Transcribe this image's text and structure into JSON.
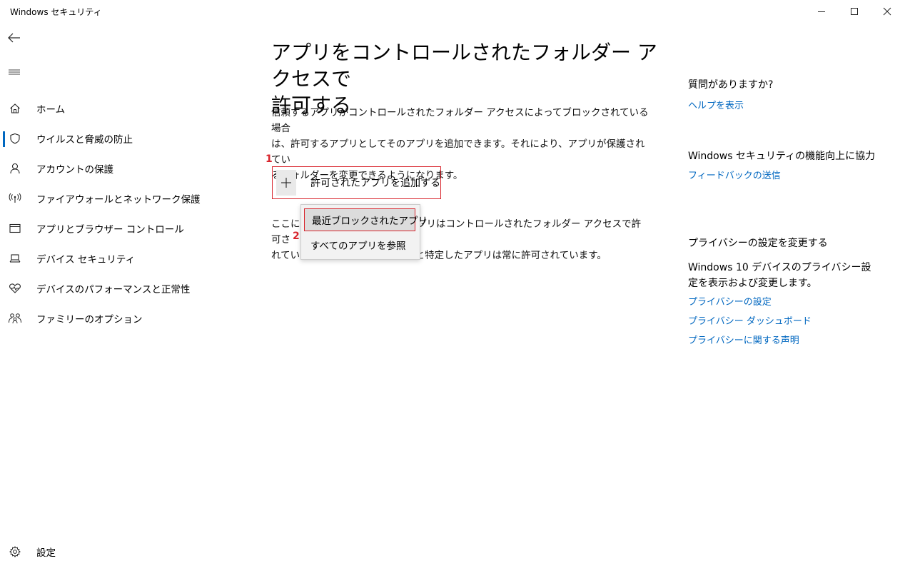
{
  "app": {
    "title": "Windows セキュリティ"
  },
  "window_controls": {
    "minimize": "minimize-icon",
    "maximize": "maximize-icon",
    "close": "close-icon"
  },
  "nav": {
    "items": [
      {
        "label": "ホーム",
        "icon": "home-icon",
        "active": false
      },
      {
        "label": "ウイルスと脅威の防止",
        "icon": "shield-icon",
        "active": true
      },
      {
        "label": "アカウントの保護",
        "icon": "person-icon",
        "active": false
      },
      {
        "label": "ファイアウォールとネットワーク保護",
        "icon": "wifi-antenna-icon",
        "active": false
      },
      {
        "label": "アプリとブラウザー コントロール",
        "icon": "browser-window-icon",
        "active": false
      },
      {
        "label": "デバイス セキュリティ",
        "icon": "laptop-icon",
        "active": false
      },
      {
        "label": "デバイスのパフォーマンスと正常性",
        "icon": "heart-icon",
        "active": false
      },
      {
        "label": "ファミリーのオプション",
        "icon": "family-icon",
        "active": false
      }
    ],
    "settings_label": "設定"
  },
  "main": {
    "title_line1": "アプリをコントロールされたフォルダー アクセスで",
    "title_line2": "許可する",
    "description_line1": "信頼するアプリがコントロールされたフォルダー アクセスによってブロックされている場合",
    "description_line2": "は、許可するアプリとしてそのアプリを追加できます。それにより、アプリが保護されてい",
    "description_line3": "るフォルダーを変更できるようになります。",
    "add_button_label": "許可されたアプリを追加する",
    "info_line1": "ここに追加したアプリは、その他のアプリはコントロールされたフォルダー アクセスで許可さ",
    "info_line2": "れていると特定したアプリは常に許可されています。",
    "info_line1_visible_a": "ここに追",
    "info_line1_visible_b": "プリはコントロールされたフォルダー アクセスで許可さ",
    "info_line2_visible_a": "れてい",
    "info_line2_visible_b": "リと特定したアプリは常に許可されています。"
  },
  "dropdown": {
    "items": [
      "最近ブロックされたアプリ",
      "すべてのアプリを参照"
    ]
  },
  "annotations": {
    "step1": "1",
    "step2": "2",
    "color": "#d8242c"
  },
  "right_panel": {
    "question_heading": "質問がありますか?",
    "help_link": "ヘルプを表示",
    "improve_heading": "Windows セキュリティの機能向上に協力",
    "feedback_link": "フィードバックの送信",
    "privacy_heading": "プライバシーの設定を変更する",
    "privacy_text": "Windows 10 デバイスのプライバシー設定を表示および変更します。",
    "privacy_links": [
      "プライバシーの設定",
      "プライバシー ダッシュボード",
      "プライバシーに関する声明"
    ]
  },
  "colors": {
    "accent": "#0067c0",
    "annotation_red": "#d8242c"
  }
}
